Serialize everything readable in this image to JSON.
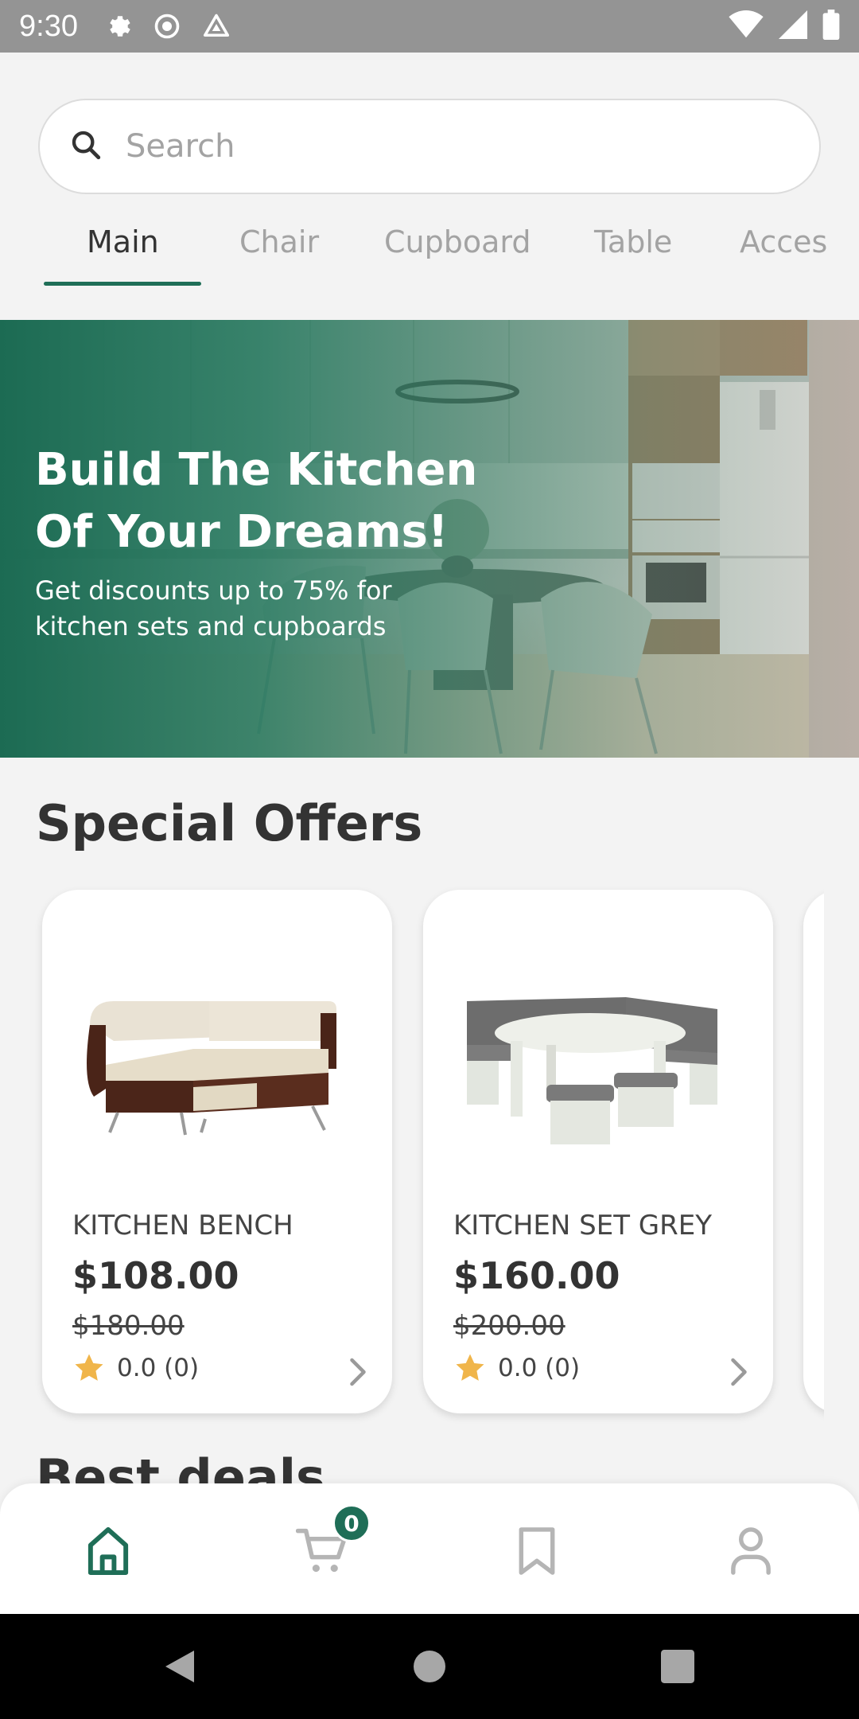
{
  "status_bar": {
    "time": "9:30",
    "left_icons": [
      "gear-icon",
      "record-icon",
      "drive-icon"
    ],
    "right_icons": [
      "wifi-icon",
      "signal-icon",
      "battery-icon"
    ]
  },
  "search": {
    "placeholder": "Search",
    "icon": "search-icon"
  },
  "tabs": [
    {
      "label": "Main",
      "active": true
    },
    {
      "label": "Chair",
      "active": false
    },
    {
      "label": "Cupboard",
      "active": false
    },
    {
      "label": "Table",
      "active": false
    },
    {
      "label": "Acces",
      "active": false
    }
  ],
  "banner": {
    "title": "Build The Kitchen Of Your Dreams!",
    "subtitle": "Get discounts up to 75% for kitchen sets and cupboards"
  },
  "special_offers": {
    "title": "Special Offers",
    "products": [
      {
        "name": "KITCHEN BENCH",
        "price": "$108.00",
        "old_price": "$180.00",
        "rating": "0.0 (0)"
      },
      {
        "name": "KITCHEN SET GREY",
        "price": "$160.00",
        "old_price": "$200.00",
        "rating": "0.0 (0)"
      }
    ]
  },
  "best_deals": {
    "title": "Best deals"
  },
  "bottom_nav": {
    "items": [
      "home-icon",
      "cart-icon",
      "bookmark-icon",
      "profile-icon"
    ],
    "cart_count": "0"
  },
  "colors": {
    "accent": "#1f6e57",
    "star": "#f0b54a",
    "background": "#f3f3f3"
  }
}
